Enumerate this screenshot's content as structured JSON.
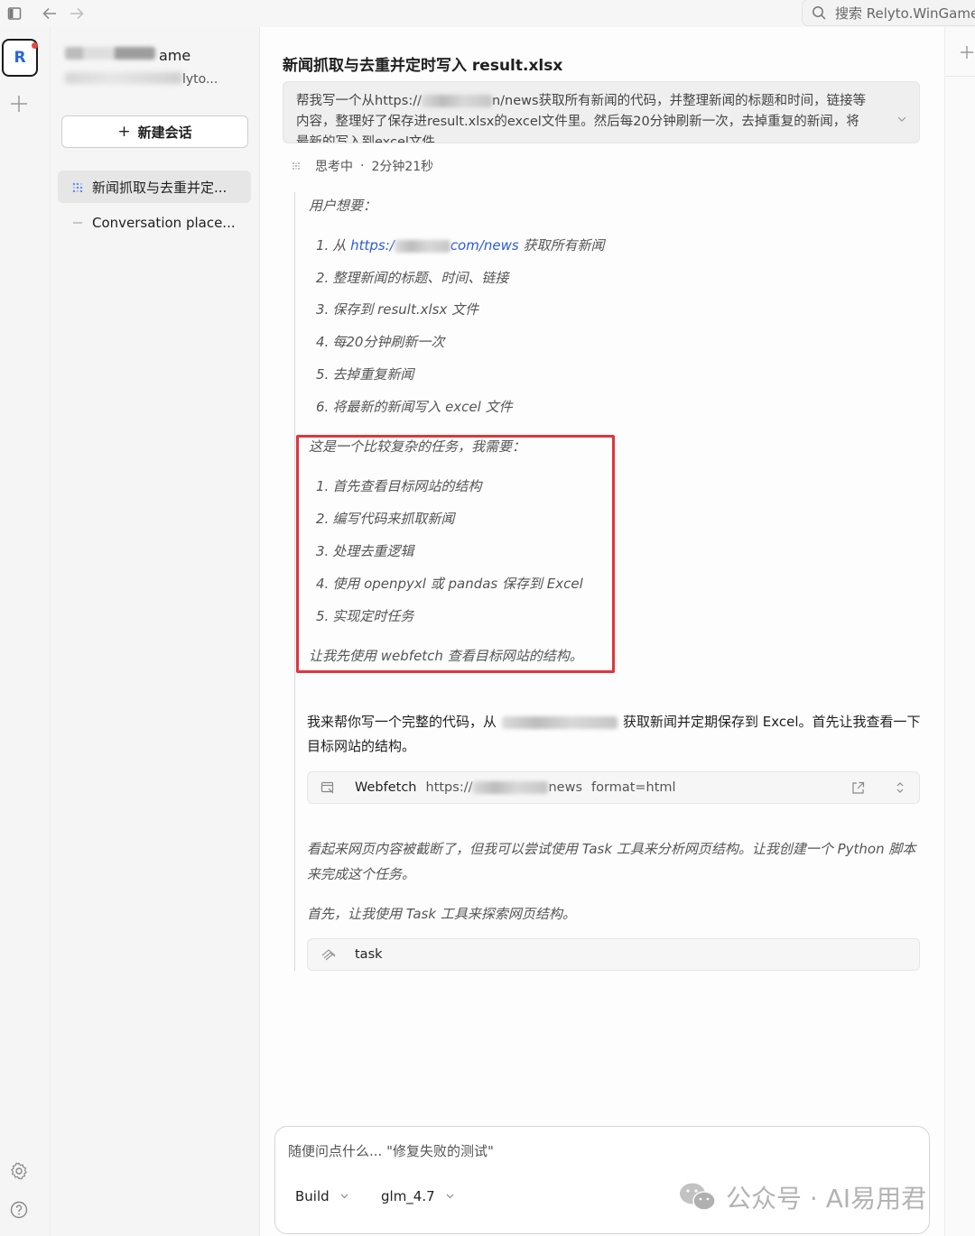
{
  "topbar": {
    "search_placeholder": "搜索 Relyto.WinGame"
  },
  "rail": {
    "avatar_letter": "R"
  },
  "sidebar": {
    "account_name": "ame",
    "account_sub": "lyto...",
    "new_chat_label": "新建会话",
    "items": [
      {
        "label": "新闻抓取与去重并定..."
      },
      {
        "label": "Conversation place..."
      }
    ]
  },
  "conversation": {
    "title": "新闻抓取与去重并定时写入 result.xlsx",
    "prompt_line1": "帮我写一个从https://",
    "prompt_line1b": "n/news获取所有新闻的代码，并整理新闻的标题和时间，链接等",
    "prompt_line2": "内容，整理好了保存进result.xlsx的excel文件里。然后每20分钟刷新一次，去掉重复的新闻，将",
    "prompt_line3": "最新的写入到excel文件",
    "thinking_label": "思考中",
    "thinking_sep": "·",
    "thinking_time": "2分钟21秒"
  },
  "thinking": {
    "intro": "用户想要：",
    "goals": [
      {
        "num": "1.",
        "text_pre": "从 ",
        "link_a": "https:/",
        "link_b": "com/news",
        "text_post": " 获取所有新闻"
      },
      {
        "num": "2.",
        "text": "整理新闻的标题、时间、链接"
      },
      {
        "num": "3.",
        "text": "保存到 result.xlsx 文件"
      },
      {
        "num": "4.",
        "text": "每20分钟刷新一次"
      },
      {
        "num": "5.",
        "text": "去掉重复新闻"
      },
      {
        "num": "6.",
        "text": "将最新的新闻写入 excel 文件"
      }
    ],
    "plan_intro": "这是一个比较复杂的任务，我需要：",
    "plan": [
      {
        "num": "1.",
        "text": "首先查看目标网站的结构"
      },
      {
        "num": "2.",
        "text": "编写代码来抓取新闻"
      },
      {
        "num": "3.",
        "text": "处理去重逻辑"
      },
      {
        "num": "4.",
        "text": "使用 openpyxl 或 pandas 保存到 Excel"
      },
      {
        "num": "5.",
        "text": "实现定时任务"
      }
    ],
    "plan_outro": "让我先使用 webfetch 查看目标网站的结构。"
  },
  "reply": {
    "line1a": "我来帮你写一个完整的代码，从",
    "line1b": "获取新闻并定期保存到 Excel。首先让我查看一下",
    "line2": "目标网站的结构。",
    "webfetch_tool": "Webfetch",
    "webfetch_url_a": "https://",
    "webfetch_url_b": "news",
    "webfetch_format": "format=html",
    "note1_line1": "看起来网页内容被截断了，但我可以尝试使用 Task 工具来分析网页结构。让我创建一个 Python 脚本",
    "note1_line2": "来完成这个任务。",
    "note2": "首先，让我使用 Task 工具来探索网页结构。",
    "task_tool": "task"
  },
  "input": {
    "placeholder": "随便问点什么... \"修复失败的测试\"",
    "mode": "Build",
    "model": "glm_4.7"
  },
  "watermark": {
    "text": "公众号 · AI易用君"
  }
}
